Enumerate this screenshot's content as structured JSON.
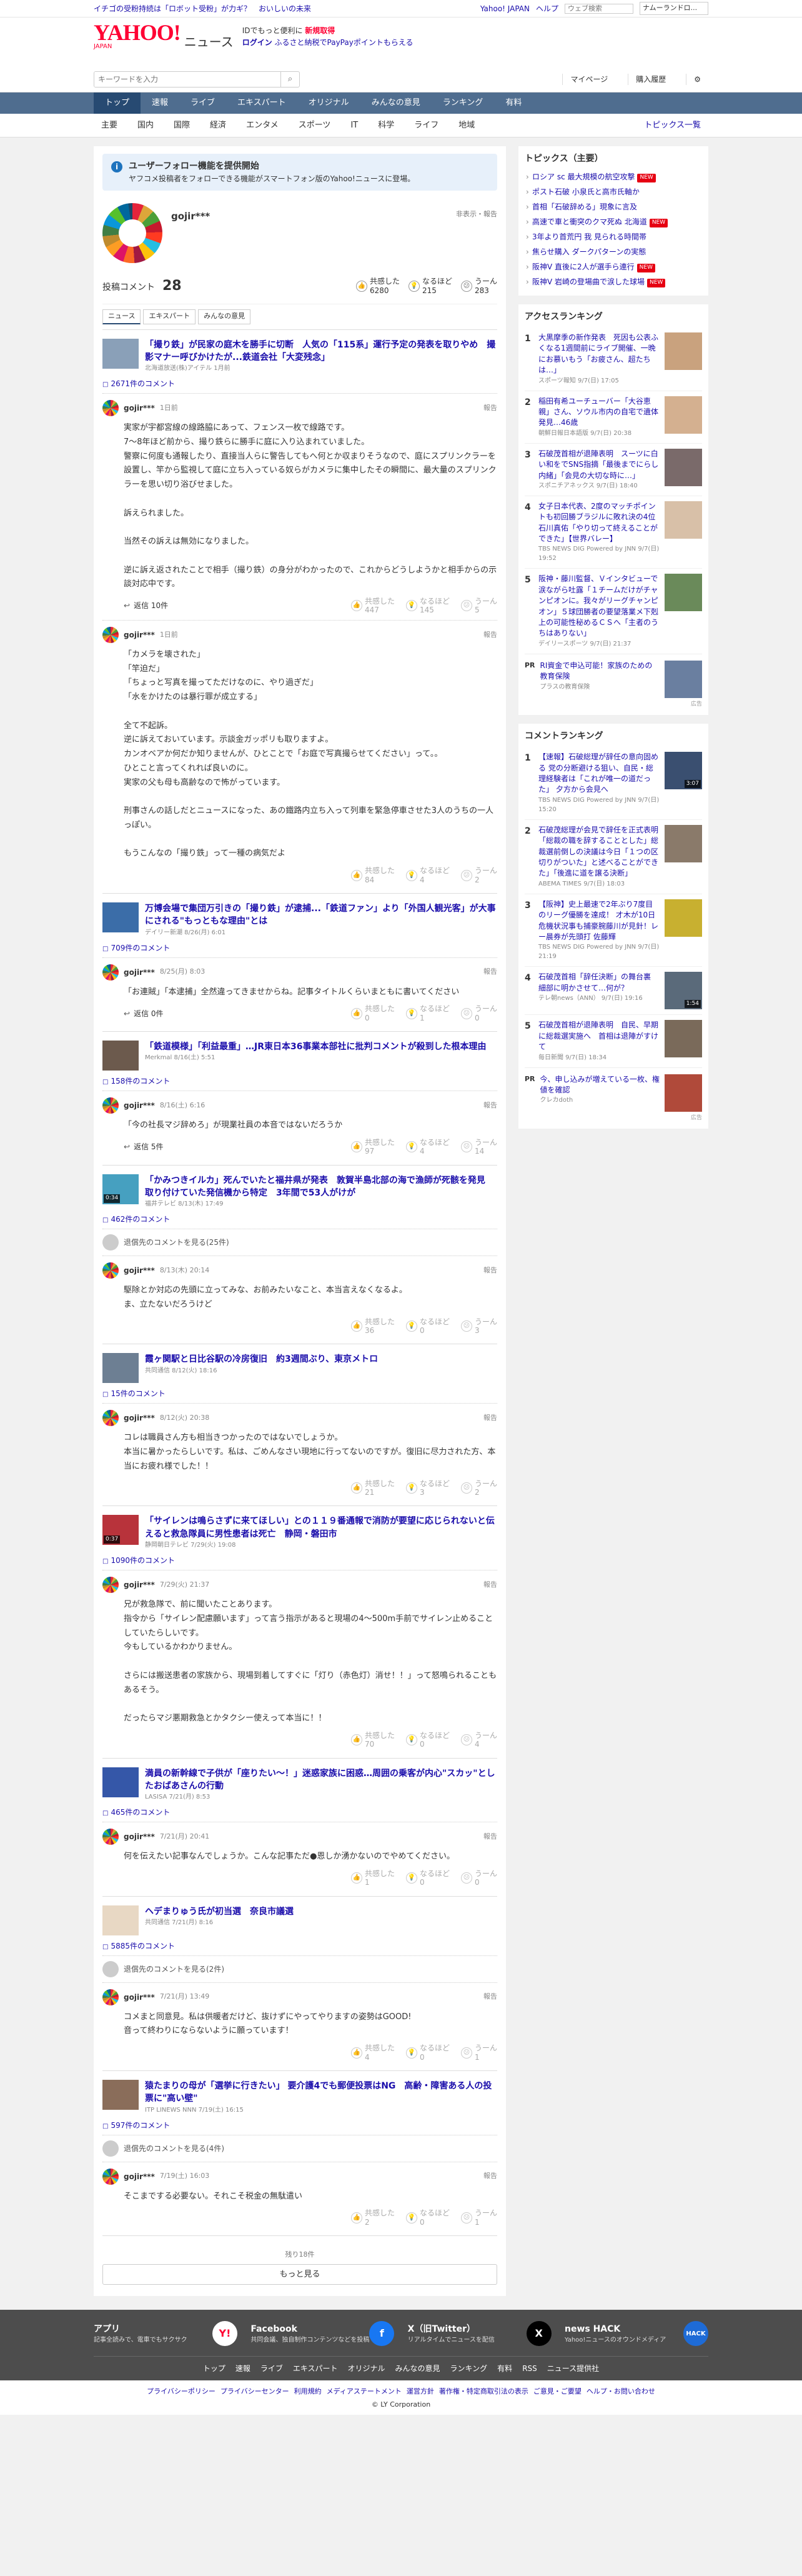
{
  "topbar": {
    "promo_text": "イチゴの受粉持続は「ロボット受粉」が力ギ？　おいしいの未来",
    "yahoo_japan": "Yahoo! JAPAN",
    "help": "ヘルプ",
    "search_placeholder": "ウェブ検索",
    "mode_select": "ナムーランドロ..."
  },
  "header": {
    "logo_text": "YAHOO!",
    "logo_sub": "JAPAN",
    "service": "ニュース",
    "login_line1": "IDでもっと便利に",
    "new_register": "新規取得",
    "login": "ログイン",
    "furusato": "ふるさと納税でPayPayポイントもらえる"
  },
  "search": {
    "placeholder": "キーワードを入力",
    "mypage": "マイページ",
    "purchase_history": "購入履歴"
  },
  "cat_nav": [
    "トップ",
    "速報",
    "ライブ",
    "エキスパート",
    "オリジナル",
    "みんなの意見",
    "ランキング",
    "有料"
  ],
  "topic_nav": [
    "主要",
    "国内",
    "国際",
    "経済",
    "エンタメ",
    "スポーツ",
    "IT",
    "科学",
    "ライフ",
    "地域"
  ],
  "topic_all": "トピックス一覧",
  "notice": {
    "title": "ユーザーフォロー機能を提供開始",
    "body": "ヤフコメ投稿者をフォローできる機能がスマートフォン版のYahoo!ニュースに登場。"
  },
  "profile": {
    "name": "gojir***",
    "report": "非表示・報告",
    "comment_count_label": "投稿コメント",
    "comment_count": "28",
    "reactions": [
      {
        "label": "共感した",
        "count": "6280",
        "icon": "thumb-up-icon"
      },
      {
        "label": "なるほど",
        "count": "215",
        "icon": "lightbulb-icon"
      },
      {
        "label": "うーん",
        "count": "283",
        "icon": "hmm-icon"
      }
    ]
  },
  "tabs": [
    "ニュース",
    "エキスパート",
    "みんなの意見"
  ],
  "articles": [
    {
      "title": "「撮り鉄」が民家の庭木を勝手に切断　人気の「115系」運行予定の発表を取りやめ　撮影マナー呼びかけたが...鉄道会社「大変残念」",
      "source": "北海道放送(株)アイテル 1月前",
      "comments": "2671件のコメント",
      "thumb": "#8aa0b8",
      "items": [
        {
          "type": "comment",
          "user": "gojir***",
          "date": "1日前",
          "body": "実家が宇都宮線の線路脇にあって、フェンス一枚で線路です。\n7〜8年ほど前から、撮り鉄らに勝手に庭に入り込まれていました。\n警察に何度も通報したり、直接当人らに警告してもへ何とか収まりそうなので、庭にスプリンクラーを設置し、竿から監視して庭に立ち入っている奴らがカメラに集中したその瞬間に、最大量のスプリンクラーを思い切り浴びせました。\n\n訴えられました。\n\n当然その訴えは無効になりました。\n\n逆に訴え返されたことで相手（撮り鉄）の身分がわかったので、これからどうしようかと相手からの示談対応中です。",
          "replies": "返信 10件",
          "react": [
            "447",
            "145",
            "5"
          ]
        },
        {
          "type": "comment",
          "user": "gojir***",
          "date": "1日前",
          "body": "「カメラを壊された」\n「竿迫だ」\n「ちょっと写真を撮ってただけなのに、やり過ぎだ」\n「水をかけたのは暴行罪が成立する」\n\n全て不起訴。\n逆に訴えておいています。示談金ガッポリも取りますよ。\nカンオベアか何だか知りませんが、ひとことで「お庭で写真撮らせてください」って。。\nひとこと言ってくれれば良いのに。\n実家の父も母も高齢なので怖がっています。\n\n刑事さんの話しだとニュースになった、あの鐵路内立ち入って列車を緊急停車させた3人のうちの一人っぽい。\n\nもうこんなの「撮り鉄」って一種の病気だよ",
          "replies": "",
          "react": [
            "84",
            "4",
            "2"
          ]
        }
      ]
    },
    {
      "title": "万博会場で集団万引きの「撮り鉄」が逮捕...「鉄道ファン」より「外国人観光客」が大事にされる\"もっともな理由\"とは",
      "source": "デイリー新潮 8/26(月) 6:01",
      "comments": "709件のコメント",
      "thumb": "#3b6da8",
      "items": [
        {
          "type": "comment",
          "user": "gojir***",
          "date": "8/25(月) 8:03",
          "body": "「お連賊」「本逮捕」全然違ってきませからね。記事タイトルくらいまともに書いてください",
          "replies": "返信 0件",
          "react": [
            "0",
            "1",
            "0"
          ]
        }
      ]
    },
    {
      "title": "「鉄道模様」「利益最重」…JR東日本36事業本部社に批判コメントが殺到した根本理由",
      "source": "Merkmal 8/16(土) 5:51",
      "comments": "158件のコメント",
      "thumb": "#6c5a4d",
      "items": [
        {
          "type": "comment",
          "user": "gojir***",
          "date": "8/16(土) 6:16",
          "body": "「今の社長マジ辞めろ」が現業社員の本音ではないだろうか",
          "replies": "返信 5件",
          "react": [
            "97",
            "4",
            "14"
          ]
        }
      ]
    },
    {
      "title": "「かみつきイルカ」死んでいたと福井県が発表　敦賀半島北部の海で漁師が死骸を発見　取り付けていた発信機から特定　3年間で53人がけが",
      "source": "福井テレビ 8/13(木) 17:49",
      "comments": "462件のコメント",
      "thumb": "#46a0c0",
      "video": "0:34",
      "items": [
        {
          "type": "hidden",
          "text": "退償先のコメントを見る(25件)"
        },
        {
          "type": "comment",
          "user": "gojir***",
          "date": "8/13(木) 20:14",
          "body": "駆除とか対応の先頭に立ってみな、お前みたいなこと、本当言えなくなるよ。\nま、立たないだろうけど",
          "replies": "",
          "react": [
            "36",
            "0",
            "3"
          ]
        }
      ]
    },
    {
      "title": "霞ヶ関駅と日比谷駅の冷房復旧　約3週間ぶり、東京メトロ",
      "source": "共同通信 8/12(火) 18:16",
      "comments": "15件のコメント",
      "thumb": "#6d7f93",
      "items": [
        {
          "type": "comment",
          "user": "gojir***",
          "date": "8/12(火) 20:38",
          "body": "コレは職員さん方も相当きつかったのではないでしょうか。\n本当に暑かったらしいです。私は、ごめんなさい現地に行ってないのですが。復旧に尽力された方、本当にお疲れ様でした！！",
          "replies": "",
          "react": [
            "21",
            "3",
            "2"
          ]
        }
      ]
    },
    {
      "title": "「サイレンは鳴らさずに来てほしい」との１１９番通報で消防が要望に応じられないと伝えると救急隊員に男性患者は死亡　静岡・磐田市",
      "source": "静岡朝日テレビ 7/29(火) 19:08",
      "comments": "1090件のコメント",
      "thumb": "#b8333b",
      "video": "0:37",
      "items": [
        {
          "type": "comment",
          "user": "gojir***",
          "date": "7/29(火) 21:37",
          "body": "兄が救急隊で、前に聞いたことあります。\n指令から「サイレン配慮願います」って言う指示があると現場の4〜500m手前でサイレン止めることしていたらしいです。\n今もしているかわかりません。\n\nさらには搬送患者の家族から、現場到着してすぐに「灯り（赤色灯）消せ！！」って怒鳴られることもあるそう。\n\nだったらマジ悪期救急とかタクシー使えって本当に！！",
          "replies": "",
          "react": [
            "70",
            "0",
            "4"
          ]
        }
      ]
    },
    {
      "title": "満員の新幹線で子供が「座りたい～！」迷惑家族に困惑…周囲の乗客が内心\"スカッ\"としたおばあさんの行動",
      "source": "LASISA 7/21(月) 8:53",
      "comments": "465件のコメント",
      "thumb": "#3557a8",
      "items": [
        {
          "type": "comment",
          "user": "gojir***",
          "date": "7/21(月) 20:41",
          "body": "何を伝えたい記事なんでしょうか。こんな記事ただ●恩しか湧かないのでやめてください。",
          "replies": "",
          "react": [
            "1",
            "0",
            "0"
          ]
        }
      ]
    },
    {
      "title": "ヘデまりゅう氏が初当選　奈良市議選",
      "source": "共同通信 7/21(月) 8:16",
      "comments": "5885件のコメント",
      "thumb": "#e8d8c4",
      "items": [
        {
          "type": "hidden",
          "text": "退償先のコメントを見る(2件)"
        },
        {
          "type": "comment",
          "user": "gojir***",
          "date": "7/21(月) 13:49",
          "body": "コメまと同意見。私は供暖者だけど、抜けずにやってやりますの姿勢はGOOD!\n音って終わりにならないように願っています！",
          "replies": "",
          "react": [
            "4",
            "0",
            "1"
          ]
        }
      ]
    },
    {
      "title": "猿たまりの母が「選挙に行きたい」 要介護4でも郵便投票はNG　高齢・障害ある人の投票に\"高い壁\"",
      "source": "ITP LINEWS NNN 7/19(土) 16:15",
      "comments": "597件のコメント",
      "thumb": "#8a6d5a",
      "items": [
        {
          "type": "hidden",
          "text": "退償先のコメントを見る(4件)"
        },
        {
          "type": "comment",
          "user": "gojir***",
          "date": "7/19(土) 16:03",
          "body": "そこまでする必要ない。それこそ税金の無駄遣い",
          "replies": "",
          "react": [
            "2",
            "0",
            "1"
          ]
        }
      ]
    }
  ],
  "react_labels": [
    "共感した",
    "なるほど",
    "うーん"
  ],
  "report_label": "報告",
  "more": {
    "remaining": "残り18件",
    "button": "もっと見る"
  },
  "sidebar": {
    "topics_title": "トピックス（主要）",
    "topics": [
      {
        "text": "ロシア sc 最大規模の航空攻撃",
        "tag": "NEW",
        "tagc": "n"
      },
      {
        "text": "ポスト石破 小泉氏と高市氏軸か",
        "tag": "",
        "tagc": ""
      },
      {
        "text": "首相「石破辞める」現象に言及",
        "tag": "",
        "tagc": ""
      },
      {
        "text": "高速で車と衝突のクマ死ぬ 北海道",
        "tag": "NEW",
        "tagc": "n"
      },
      {
        "text": "3年より首荒円 我 見られる時間帯",
        "tag": "",
        "tagc": ""
      },
      {
        "text": "焦らせ購入 ダークパターンの実態",
        "tag": "",
        "tagc": ""
      },
      {
        "text": "阪神V 直後に2人が選手ら連行",
        "tag": "NEW",
        "tagc": "n"
      },
      {
        "text": "阪神V 岩崎の登場曲で涙した球場",
        "tag": "NEW",
        "tagc": "n"
      }
    ],
    "access_title": "アクセスランキング",
    "access": [
      {
        "rank": "1",
        "title": "大黒摩季の新作発表　死因も公表ふくなる1週間前にライブ開催、一晩にお慕いもう「お疲さん、超たちは…」",
        "src": "スポーツ報知 9/7(日) 17:05",
        "thumb": "#c9a27e"
      },
      {
        "rank": "2",
        "title": "稲田有希ユーチューバー「大谷恵親」さん、ソウル市内の自宅で遺体発見…46歳",
        "src": "朝鮮日報日本語版 9/7(日) 20:38",
        "thumb": "#d4b090"
      },
      {
        "rank": "3",
        "title": "石破茂首相が退陣表明　スーツに白い和をでSNS指摘「最後までにらし内緒」「会見の大切な時に…」",
        "src": "スポニチアネックス 9/7(日) 18:40",
        "thumb": "#7a6a6a"
      },
      {
        "rank": "4",
        "title": "女子日本代表、2度のマッチポイントも初回勝ブラジルに敗れ決の4位　石川真佑「やり切って終えることができた」【世界バレー】",
        "src": "TBS NEWS DIG Powered by JNN 9/7(日) 19:52",
        "thumb": "#d8c0a8"
      },
      {
        "rank": "5",
        "title": "阪神・藤川監督、Ｖインタビューで涙ながら吐露「１チームだけがチャンピオンに。我々がリーグチャンピオン」５球団勝者の要望落業メ下剋上の可能性秘めるＣＳへ「主者のうちはありない」",
        "src": "デイリースポーツ 9/7(日) 21:37",
        "thumb": "#6a8a5a"
      }
    ],
    "ad1": {
      "label": "PR",
      "title": "RI資金で申込可能！家族のための教育保険",
      "src": "プラスの教育保険",
      "thumb": "#6a7fa0",
      "adm": "広告"
    },
    "comment_title": "コメントランキング",
    "comment_rank": [
      {
        "rank": "1",
        "title": "【速報】石破総理が辞任の意向固める 党の分断避ける狙い、自民・総理経験者は「これが唯一の道だった」 夕方から会見へ",
        "src": "TBS NEWS DIG Powered by JNN 9/7(日) 15:20",
        "thumb": "#3a4f70",
        "video": "3:07"
      },
      {
        "rank": "2",
        "title": "石破茂総理が会見で辞任を正式表明「総裁の職を辞することとした」総裁選前倒しの決議は今日「１つの区切りがついた」と述べることができた」「後進に道を譲る決断」",
        "src": "ABEMA TIMES 9/7(日) 18:03",
        "thumb": "#8a7a6a",
        "video": ""
      },
      {
        "rank": "3",
        "title": "【阪神】史上最速で2年ぶり7度目のリーグ優勝を達成！ 才木が10日危機状況事も捕豪腕藤川が見針！レー晨券が先頭打 佐藤輝",
        "src": "TBS NEWS DIG Powered by JNN 9/7(日) 21:19",
        "thumb": "#c8b030",
        "video": ""
      },
      {
        "rank": "4",
        "title": "石破茂首相「辞任決断」の舞台裏　細部に明かさせて…何が？",
        "src": "テレ朝news（ANN） 9/7(日) 19:16",
        "thumb": "#5a6a7a",
        "video": "1:54"
      },
      {
        "rank": "5",
        "title": "石破茂首相が退陣表明　自民、早期に総裁選実施へ　首相は退陣がすけて",
        "src": "毎日新聞 9/7(日) 18:34",
        "thumb": "#7a6a5a",
        "video": ""
      }
    ],
    "ad2": {
      "label": "PR",
      "title": "今、申し込みが増えている一枚、権値を確認",
      "src": "クレカdoth",
      "thumb": "#b04a3a",
      "adm": "広告"
    }
  },
  "footer": {
    "apps": [
      {
        "title": "アプリ",
        "desc": "記事全読みで、電車でもサクサク",
        "icon": "yahoo-news-app-icon",
        "glyph": "Y!",
        "color": "#ffffff",
        "fg": "#ff0033"
      },
      {
        "title": "Facebook",
        "desc": "共同会議、独自制作コンテンツなどを投稿",
        "icon": "facebook-icon",
        "glyph": "f",
        "color": "#1877f2",
        "fg": "#ffffff"
      },
      {
        "title": "X（旧Twitter）",
        "desc": "リアルタイムでニュースを配信",
        "icon": "x-icon",
        "glyph": "X",
        "color": "#000000",
        "fg": "#ffffff"
      },
      {
        "title": "news HACK",
        "desc": "Yahoo!ニュースのオウンドメディア",
        "icon": "news-hack-icon",
        "glyph": "HACK",
        "color": "#1e6bd6",
        "fg": "#ffffff"
      }
    ],
    "links": [
      "トップ",
      "速報",
      "ライブ",
      "エキスパート",
      "オリジナル",
      "みんなの意見",
      "ランキング",
      "有料",
      "RSS",
      "ニュース提供社"
    ],
    "policy": [
      "プライバシーポリシー",
      "プライバシーセンター",
      "利用規約",
      "メディアステートメント",
      "運営方針",
      "著作権・特定商取引法の表示",
      "ご意見・ご要望",
      "ヘルプ・お問い合わせ"
    ],
    "copyright": "© LY Corporation"
  }
}
